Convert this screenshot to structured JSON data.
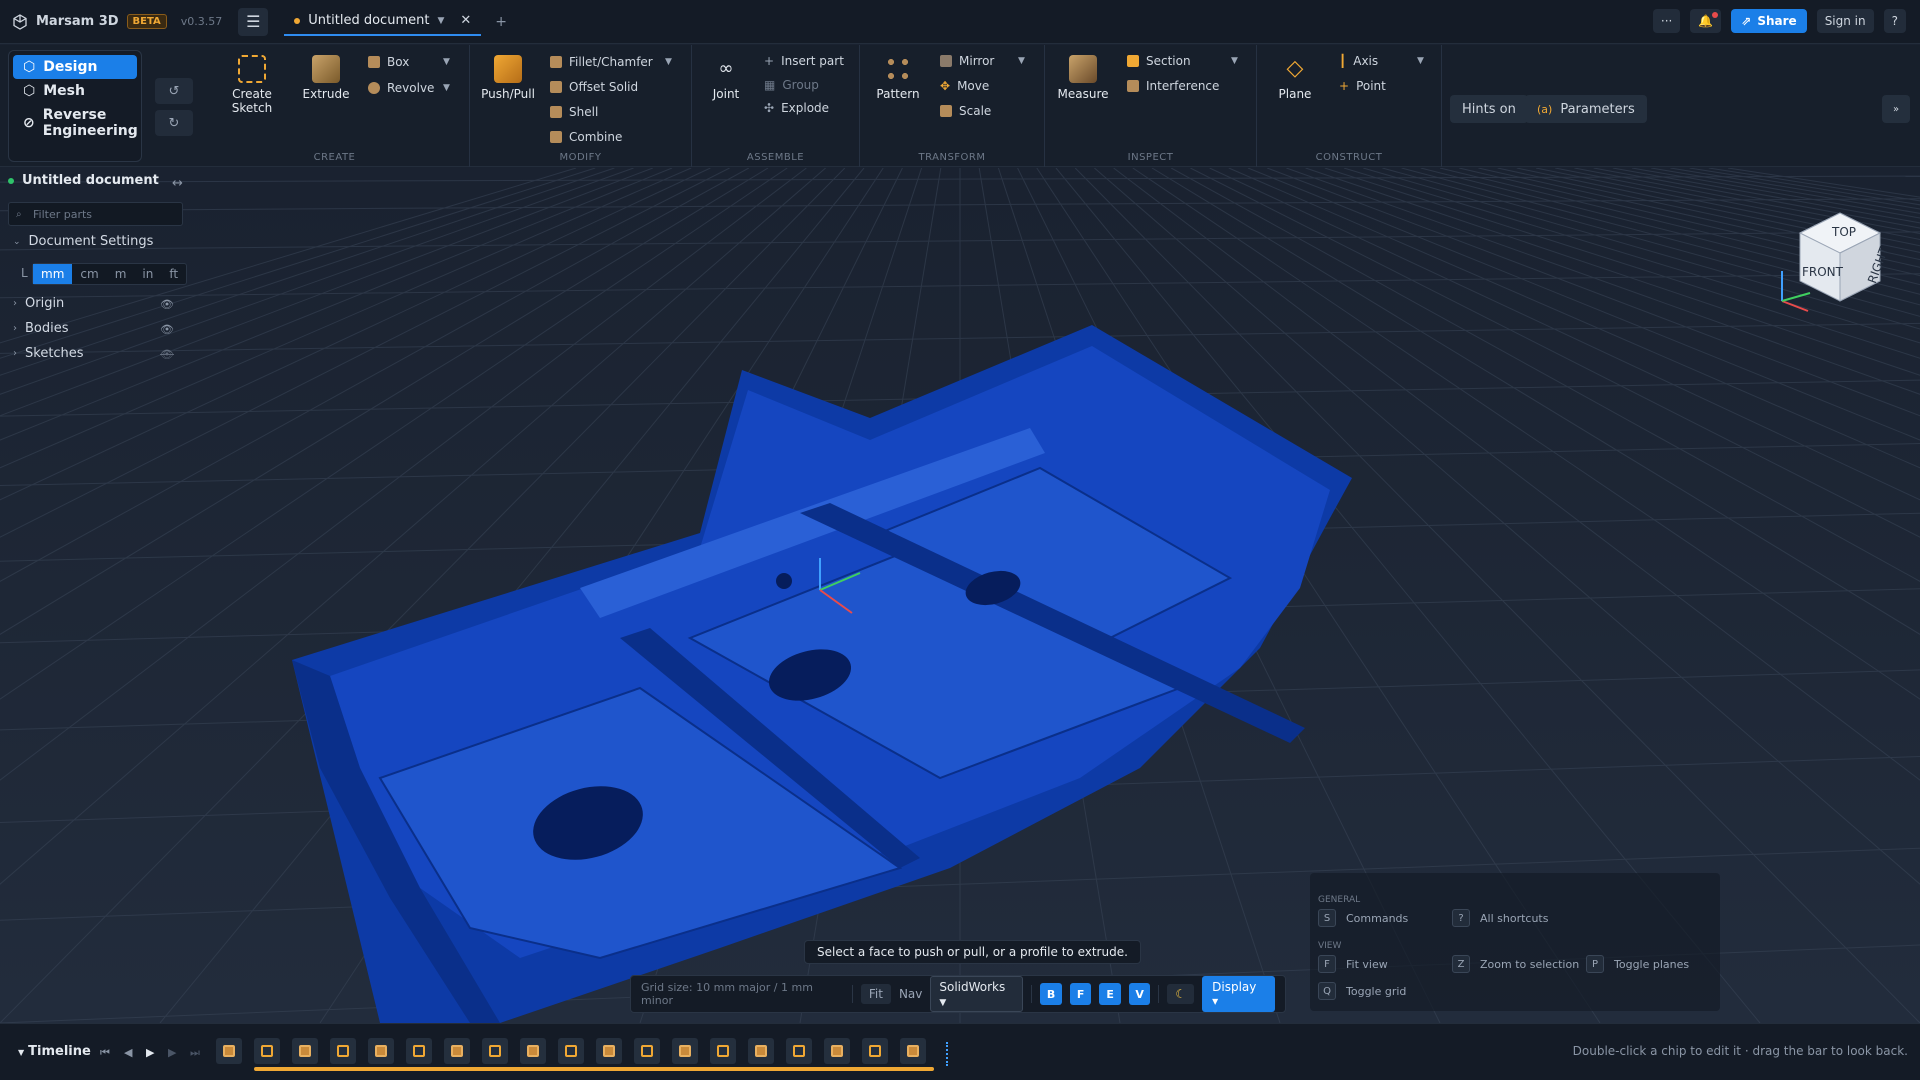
{
  "app": {
    "name": "Marsam 3D",
    "badge": "BETA",
    "version": "v0.3.57"
  },
  "tabs": [
    {
      "label": "Untitled document"
    }
  ],
  "topright": {
    "more": "···",
    "share": "Share",
    "signin": "Sign in",
    "help": "?"
  },
  "workspaces": [
    {
      "label": "Design"
    },
    {
      "label": "Mesh"
    },
    {
      "label": "Reverse Engineering"
    }
  ],
  "ribbon": {
    "create": {
      "title": "CREATE",
      "create_sketch": "Create Sketch",
      "extrude": "Extrude",
      "box": "Box",
      "revolve": "Revolve"
    },
    "modify": {
      "title": "MODIFY",
      "push_pull": "Push/Pull",
      "fillet": "Fillet/Chamfer",
      "offset": "Offset Solid",
      "shell": "Shell",
      "combine": "Combine"
    },
    "assemble": {
      "title": "ASSEMBLE",
      "joint": "Joint",
      "insert": "Insert part",
      "group": "Group",
      "explode": "Explode"
    },
    "transform": {
      "title": "TRANSFORM",
      "pattern": "Pattern",
      "mirror": "Mirror",
      "move": "Move",
      "scale": "Scale"
    },
    "inspect": {
      "title": "INSPECT",
      "measure": "Measure",
      "section": "Section",
      "interference": "Interference"
    },
    "construct": {
      "title": "CONSTRUCT",
      "plane": "Plane",
      "axis": "Axis",
      "point": "Point"
    },
    "hints": "Hints on",
    "parameters": "Parameters"
  },
  "sidebar": {
    "doc_title": "Untitled document",
    "filter_placeholder": "Filter parts",
    "doc_settings": "Document Settings",
    "unit_prefix": "L",
    "units": [
      "mm",
      "cm",
      "m",
      "in",
      "ft"
    ],
    "selected_unit": "mm",
    "items": [
      {
        "label": "Origin"
      },
      {
        "label": "Bodies"
      },
      {
        "label": "Sketches"
      }
    ]
  },
  "viewcube": {
    "top": "TOP",
    "front": "FRONT",
    "right": "RIGHT"
  },
  "status_message": "Select a face to push or pull, or a profile to extrude.",
  "bottombar": {
    "grid": "Grid size: 10 mm major / 1 mm minor",
    "fit": "Fit",
    "nav_label": "Nav",
    "nav_value": "SolidWorks",
    "view_buttons": [
      "B",
      "F",
      "E",
      "V"
    ],
    "display": "Display ▾"
  },
  "shortcuts": {
    "general_title": "GENERAL",
    "view_title": "VIEW",
    "items": [
      {
        "key": "S",
        "label": "Commands"
      },
      {
        "key": "?",
        "label": "All shortcuts"
      },
      {
        "key": "F",
        "label": "Fit view"
      },
      {
        "key": "Z",
        "label": "Zoom to selection"
      },
      {
        "key": "P",
        "label": "Toggle planes"
      },
      {
        "key": "Q",
        "label": "Toggle grid"
      }
    ]
  },
  "timeline": {
    "label": "Timeline",
    "hint": "Double-click a chip to edit it · drag the bar to look back."
  },
  "colors": {
    "accent": "#1b7fe8",
    "model": "#0f3fb0",
    "warning": "#f0a834"
  }
}
